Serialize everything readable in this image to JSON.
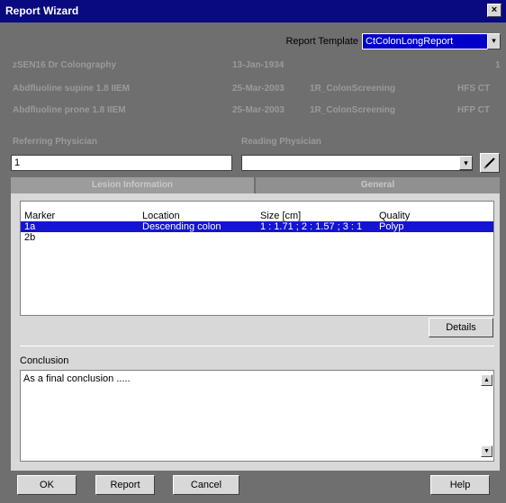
{
  "window": {
    "title": "Report Wizard",
    "close_symbol": "×"
  },
  "template": {
    "label": "Report Template",
    "value": "CtColonLongReport",
    "arrow": "▾"
  },
  "patient_rows": [
    {
      "c1": "zSEN16 Dr Colongraphy",
      "c2": "13-Jan-1934",
      "c3": "",
      "c4": "1"
    },
    {
      "c1": "Abdfluoline  supine 1.8 IIEM",
      "c2": "25-Mar-2003",
      "c3": "1R_ColonScreening",
      "c4": "HFS   CT"
    },
    {
      "c1": "Abdfluoline  prone 1.8 IIEM",
      "c2": "25-Mar-2003",
      "c3": "1R_ColonScreening",
      "c4": "HFP   CT"
    }
  ],
  "physicians": {
    "referring_label": "Referring Physician",
    "reading_label": "Reading Physician",
    "referring_value": "1"
  },
  "tabs": [
    {
      "label": "Lesion Information"
    },
    {
      "label": "General"
    }
  ],
  "lesions": {
    "headers": [
      "Marker",
      "Location",
      "Size [cm]",
      "Quality"
    ],
    "rows": [
      [
        "1a",
        "Descending colon",
        "1 : 1.71 ; 2 : 1.57 ; 3 : 1",
        "Polyp"
      ],
      [
        "2b",
        "",
        "",
        ""
      ]
    ]
  },
  "details_label": "Details",
  "conclusion": {
    "label": "Conclusion",
    "text": "As a final conclusion ....."
  },
  "buttons": {
    "ok": "OK",
    "report": "Report",
    "cancel": "Cancel",
    "help": "Help"
  },
  "colors": {
    "title_bar": "#0a0a80",
    "selection": "#1414d2",
    "dialog_bg": "#6f6f6f",
    "panel_bg": "#d8d8d8"
  }
}
